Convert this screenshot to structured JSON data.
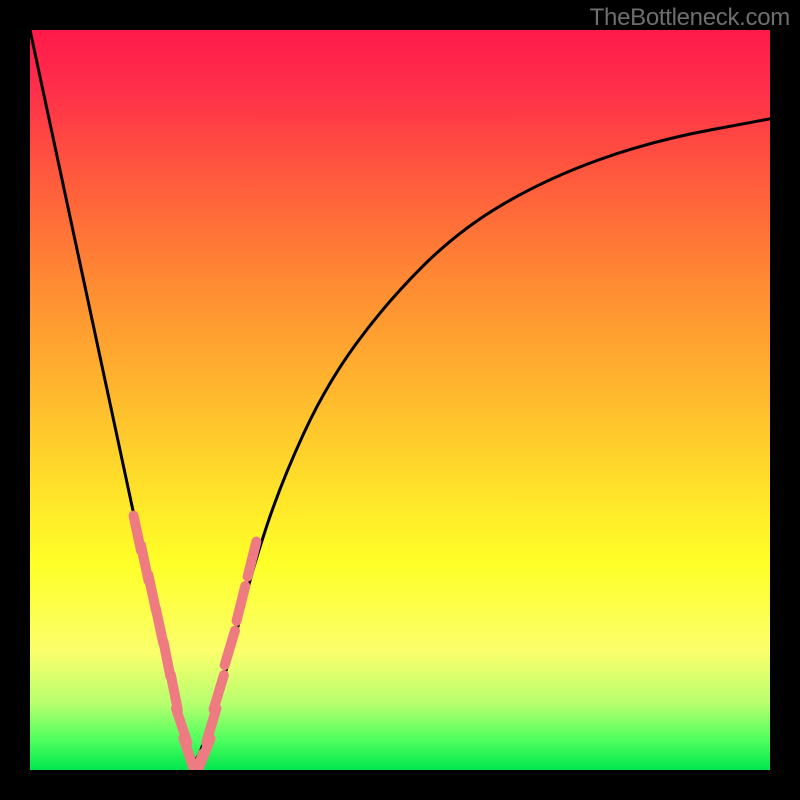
{
  "watermark": "TheBottleneck.com",
  "chart_data": {
    "type": "line",
    "title": "",
    "xlabel": "",
    "ylabel": "",
    "xlim": [
      0,
      1
    ],
    "ylim": [
      0,
      1
    ],
    "note": "V-shaped bottleneck curve: y is the bottleneck metric (lower is better, green). Curve descends from top-left to a minimum near x≈0.22 then rises toward upper-right. Values are read off the gradient/position, normalized to [0,1].",
    "series": [
      {
        "name": "bottleneck-curve",
        "x": [
          0.0,
          0.03,
          0.06,
          0.09,
          0.12,
          0.15,
          0.18,
          0.2,
          0.22,
          0.24,
          0.27,
          0.3,
          0.34,
          0.4,
          0.48,
          0.58,
          0.7,
          0.84,
          1.0
        ],
        "y": [
          1.0,
          0.86,
          0.72,
          0.58,
          0.44,
          0.3,
          0.16,
          0.06,
          0.0,
          0.05,
          0.15,
          0.27,
          0.39,
          0.52,
          0.63,
          0.73,
          0.8,
          0.85,
          0.88
        ]
      }
    ],
    "markers": {
      "name": "tick-marks",
      "color": "#ee7b82",
      "description": "short pink tick marks tangent to the curve near the bottom of the V",
      "points_x": [
        0.145,
        0.155,
        0.165,
        0.175,
        0.185,
        0.195,
        0.205,
        0.215,
        0.225,
        0.235,
        0.245,
        0.255,
        0.27,
        0.285,
        0.3
      ],
      "points_y": [
        0.32,
        0.28,
        0.24,
        0.195,
        0.15,
        0.105,
        0.06,
        0.02,
        0.0,
        0.02,
        0.06,
        0.105,
        0.165,
        0.225,
        0.285
      ]
    }
  }
}
